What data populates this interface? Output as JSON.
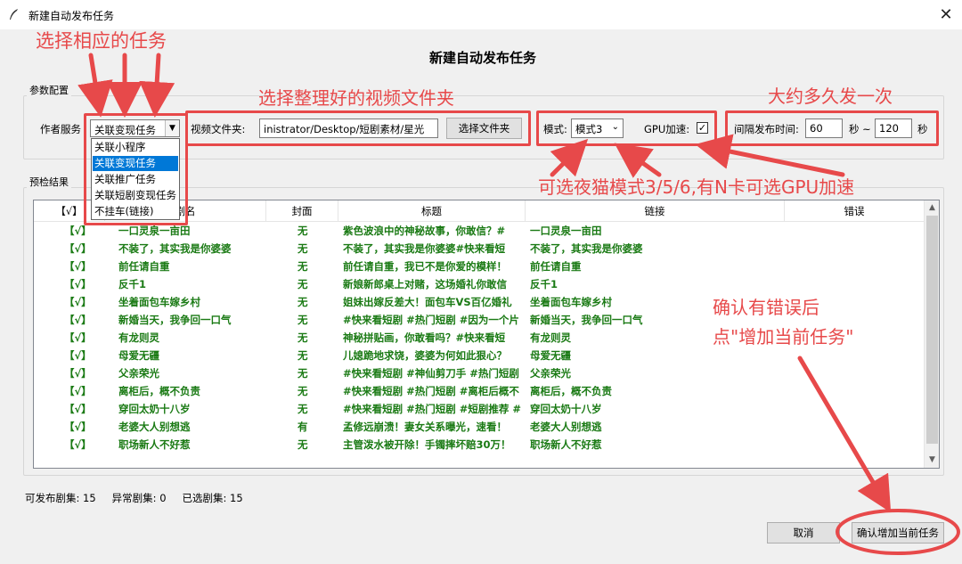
{
  "window": {
    "title": "新建自动发布任务",
    "close_glyph": "✕"
  },
  "dialog": {
    "heading": "新建自动发布任务"
  },
  "params": {
    "group_label": "参数配置",
    "author_label": "作者服务",
    "author_value": "关联变现任务",
    "author_options": [
      "关联小程序",
      "关联变现任务",
      "关联推广任务",
      "关联短剧变现任务",
      "不挂车(链接)"
    ],
    "author_selected_index": 1,
    "folder_label": "视频文件夹:",
    "folder_value": "inistrator/Desktop/短剧素材/星光",
    "choose_folder_button": "选择文件夹",
    "mode_label": "模式:",
    "mode_value": "模式3",
    "gpu_label": "GPU加速:",
    "gpu_checked": true,
    "gpu_check_glyph": "✓",
    "interval_label": "间隔发布时间:",
    "interval_min": "60",
    "interval_sep": "秒 ~",
    "interval_max": "120",
    "interval_unit": "秒"
  },
  "precheck": {
    "group_label": "预检结果",
    "columns": [
      "【√】",
      "剧名",
      "封面",
      "标题",
      "链接",
      "错误"
    ],
    "rows": [
      {
        "check": "【√】",
        "name": "一口灵泉一亩田",
        "cover": "无",
        "title": "紫色波浪中的神秘故事，你敢信？#",
        "link": "一口灵泉一亩田",
        "error": ""
      },
      {
        "check": "【√】",
        "name": "不装了，其实我是你婆婆",
        "cover": "无",
        "title": "不装了，其实我是你婆婆#快来看短",
        "link": "不装了，其实我是你婆婆",
        "error": ""
      },
      {
        "check": "【√】",
        "name": "前任请自重",
        "cover": "无",
        "title": "前任请自重，我已不是你爱的模样！",
        "link": "前任请自重",
        "error": ""
      },
      {
        "check": "【√】",
        "name": "反千1",
        "cover": "无",
        "title": "新娘新郎桌上对赌，这场婚礼你敢信",
        "link": "反千1",
        "error": ""
      },
      {
        "check": "【√】",
        "name": "坐着面包车嫁乡村",
        "cover": "无",
        "title": "姐妹出嫁反差大！面包车VS百亿婚礼",
        "link": "坐着面包车嫁乡村",
        "error": ""
      },
      {
        "check": "【√】",
        "name": "新婚当天，我争回一口气",
        "cover": "无",
        "title": "#快来看短剧 #热门短剧 #因为一个片",
        "link": "新婚当天，我争回一口气",
        "error": ""
      },
      {
        "check": "【√】",
        "name": "有龙则灵",
        "cover": "无",
        "title": "神秘拼贴画，你敢看吗？#快来看短",
        "link": "有龙则灵",
        "error": ""
      },
      {
        "check": "【√】",
        "name": "母爱无疆",
        "cover": "无",
        "title": "儿媳跪地求饶，婆婆为何如此狠心？",
        "link": "母爱无疆",
        "error": ""
      },
      {
        "check": "【√】",
        "name": "父亲荣光",
        "cover": "无",
        "title": "#快来看短剧 #神仙剪刀手 #热门短剧",
        "link": "父亲荣光",
        "error": ""
      },
      {
        "check": "【√】",
        "name": "离柜后，概不负责",
        "cover": "无",
        "title": "#快来看短剧 #热门短剧 #离柜后概不",
        "link": "离柜后，概不负责",
        "error": ""
      },
      {
        "check": "【√】",
        "name": "穿回太奶十八岁",
        "cover": "无",
        "title": "#快来看短剧 #热门短剧 #短剧推荐 #",
        "link": "穿回太奶十八岁",
        "error": ""
      },
      {
        "check": "【√】",
        "name": "老婆大人别想逃",
        "cover": "有",
        "title": "孟修远崩溃！妻女关系曝光，速看！",
        "link": "老婆大人别想逃",
        "error": ""
      },
      {
        "check": "【√】",
        "name": "职场新人不好惹",
        "cover": "无",
        "title": "主管泼水被开除！手镯摔坏赔30万！",
        "link": "职场新人不好惹",
        "error": ""
      }
    ]
  },
  "status": {
    "publishable": "可发布剧集: 15",
    "abnormal": "异常剧集: 0",
    "selected": "已选剧集: 15"
  },
  "buttons": {
    "cancel": "取消",
    "confirm": "确认增加当前任务"
  },
  "annotations": {
    "color": "#e7494a",
    "choose_task": "选择相应的任务",
    "choose_folder": "选择整理好的视频文件夹",
    "interval_hint": "大约多久发一次",
    "mode_hint": "可选夜猫模式3/5/6,有N卡可选GPU加速",
    "confirm_hint_line1": "确认有错误后",
    "confirm_hint_line2": "点\"增加当前任务\""
  }
}
